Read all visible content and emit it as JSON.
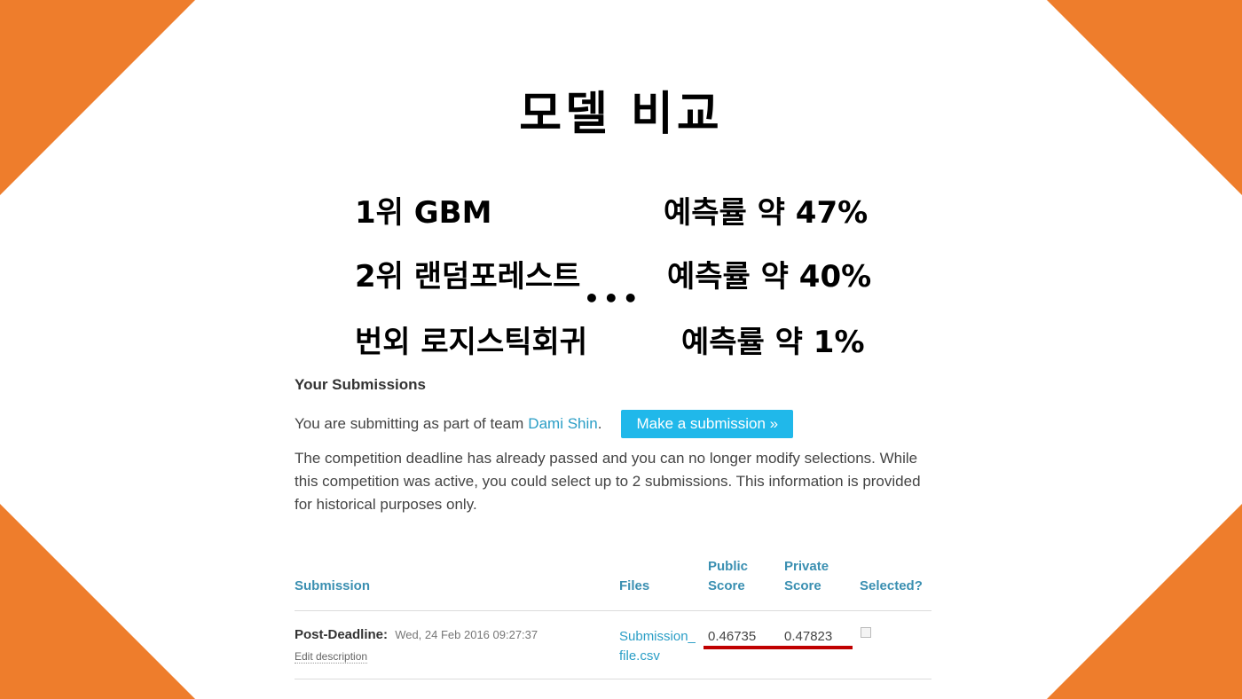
{
  "slide": {
    "title": "모델 비교",
    "rankings": [
      {
        "name": "1위 GBM",
        "rate": "예측률 약 47%"
      },
      {
        "name": "2위 랜덤포레스트",
        "rate": "예측률 약 40%"
      },
      {
        "name": "번외 로지스틱회귀",
        "rate": "예측률 약 1%"
      }
    ],
    "ellipsis": "•••"
  },
  "submissions": {
    "title": "Your Submissions",
    "team_prefix": "You are submitting as part of team",
    "team_name": "Dami Shin",
    "team_suffix": ".",
    "submit_button": "Make a submission »",
    "deadline_text": "The competition deadline has already passed and you can no longer modify selections. While this competition was active, you could select up to 2 submissions. This information is provided for historical purposes only."
  },
  "table": {
    "headers": {
      "submission": "Submission",
      "files": "Files",
      "public_1": "Public",
      "public_2": "Score",
      "private_1": "Private",
      "private_2": "Score",
      "selected": "Selected?"
    },
    "rows": [
      {
        "label": "Post-Deadline:",
        "date": "Wed, 24 Feb 2016 09:27:37",
        "edit": "Edit description",
        "file": "Submission_file.csv",
        "public_score": "0.46735",
        "private_score": "0.47823",
        "selected": false
      }
    ]
  },
  "colors": {
    "accent_orange": "#ee7d2c",
    "link_blue": "#2a9ec6",
    "button_blue": "#20b8ea",
    "highlight_red": "#c00000"
  }
}
